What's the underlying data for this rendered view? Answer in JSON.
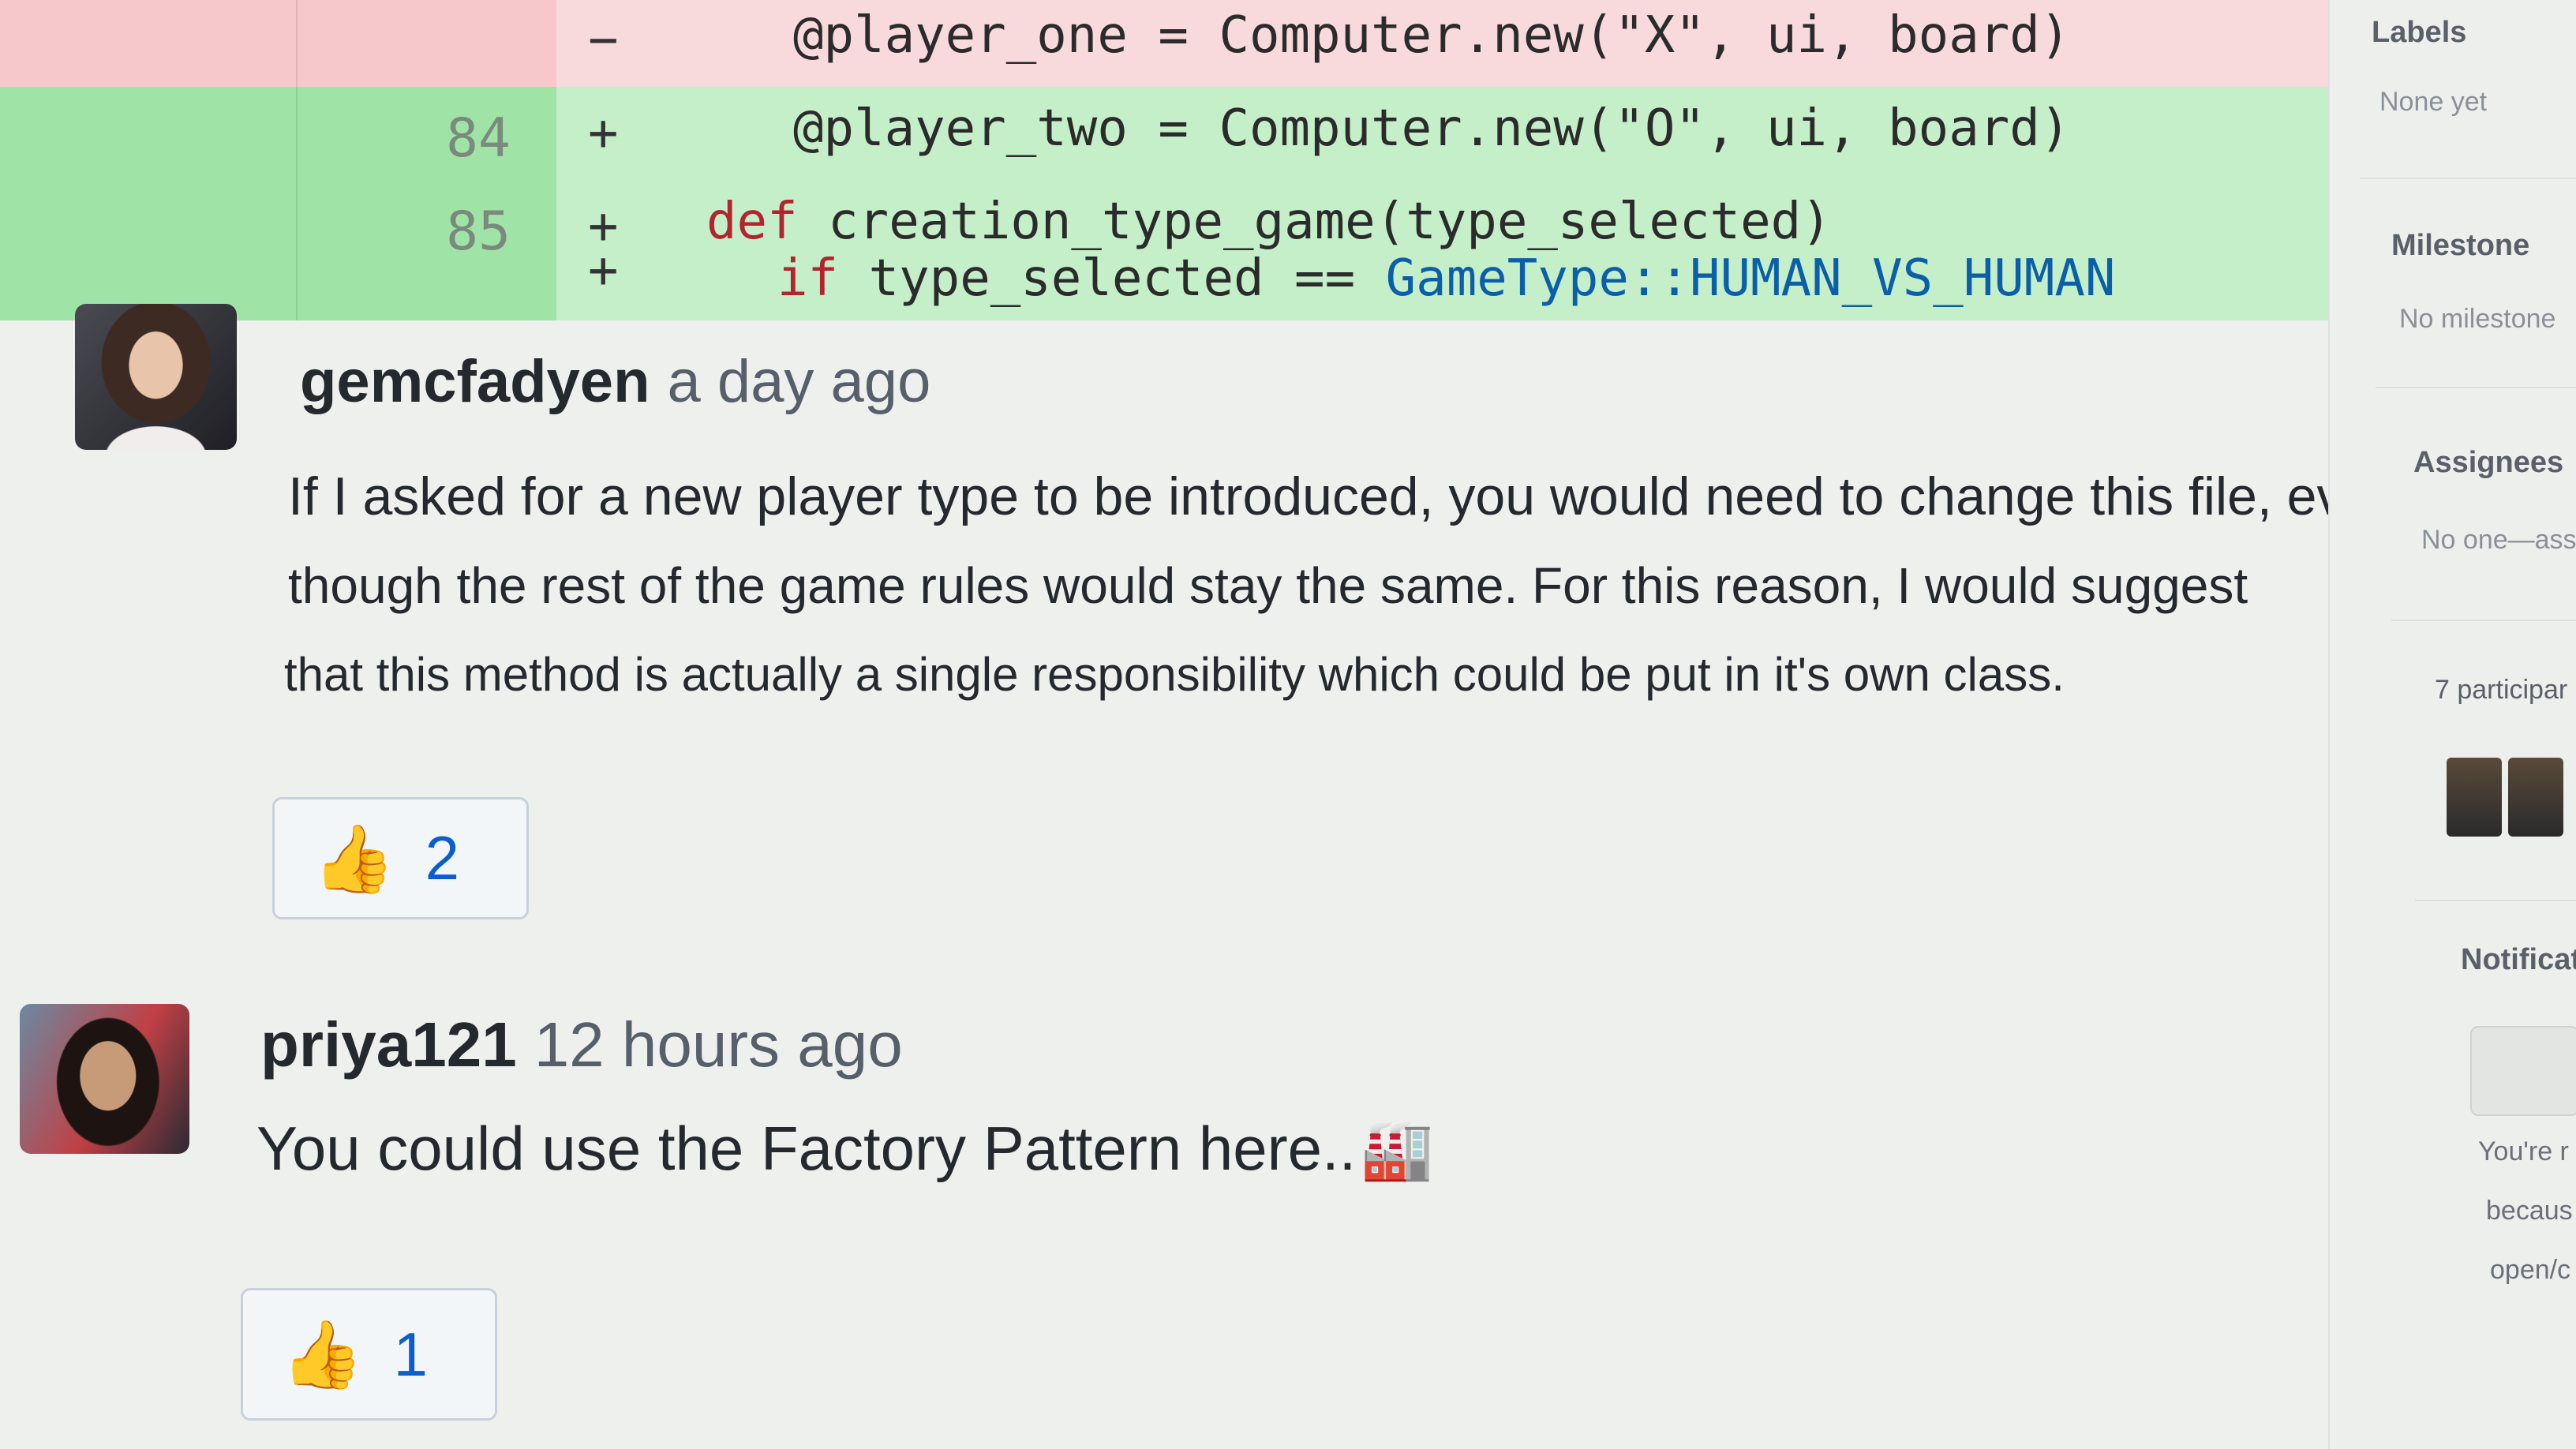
{
  "diff": {
    "lines": [
      {
        "type": "del",
        "num": "",
        "sign": "−",
        "code": "@player_one = Computer.new(\"X\", ui, board)"
      },
      {
        "type": "add",
        "num": "84",
        "sign": "+",
        "code": "@player_two = Computer.new(\"O\", ui, board)"
      },
      {
        "type": "add",
        "num": "85",
        "sign": "+",
        "keyword": "def",
        "code": "creation_type_game(type_selected)"
      },
      {
        "type": "add",
        "num": "",
        "sign": "+",
        "keyword": "if",
        "code": "type_selected ==",
        "constant": "GameType::HUMAN_VS_HUMAN"
      }
    ]
  },
  "comments": [
    {
      "author": "gemcfadyen",
      "time": "a day ago",
      "body": [
        "If I asked for a new player type to be introduced, you would need to change this file, even",
        "though the rest of the game rules would stay the same. For this reason, I would suggest",
        "that this method is actually a single responsibility which could be put in it's own class."
      ],
      "reaction": {
        "emoji": "👍",
        "count": "2"
      }
    },
    {
      "author": "priya121",
      "time": "12 hours ago",
      "body": [
        "You could use the Factory Pattern here.."
      ],
      "factory_icon": "🏭",
      "reaction": {
        "emoji": "👍",
        "count": "1"
      }
    }
  ],
  "sidebar": {
    "labels_heading": "Labels",
    "labels_value": "None yet",
    "milestone_heading": "Milestone",
    "milestone_value": "No milestone",
    "assignees_heading": "Assignees",
    "assignees_value": "No one—assi",
    "participants": "7 participar",
    "notifications_heading": "Notificat",
    "notif_line1": "You're r",
    "notif_line2": "becaus",
    "notif_line3": "open/c"
  },
  "colors": {
    "added_line": "#c5efc9",
    "removed_line": "#f9dadc",
    "keyword": "#b3242e",
    "link_blue": "#0b5fcc"
  }
}
